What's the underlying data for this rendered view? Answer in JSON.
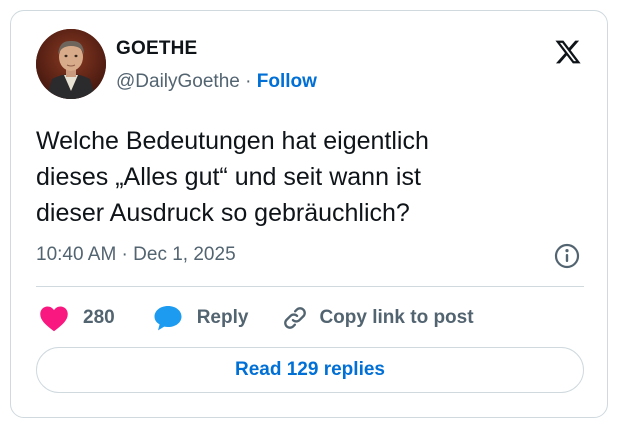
{
  "author": {
    "name": "GOETHE",
    "handle": "@DailyGoethe",
    "separator": " · ",
    "follow_label": "Follow"
  },
  "tweet": {
    "text": "Welche Bedeutungen hat eigentlich\ndieses „Alles gut“ und seit wann ist\ndieser Ausdruck so gebräuchlich?",
    "time": "10:40 AM",
    "separator": " · ",
    "date": "Dec 1, 2025"
  },
  "actions": {
    "like_count": "280",
    "reply_label": "Reply",
    "copy_link_label": "Copy link to post"
  },
  "read_replies_label": "Read 129 replies",
  "icons": {
    "brand": "x-logo-icon",
    "info": "info-icon",
    "like": "heart-icon",
    "reply": "speech-bubble-icon",
    "copy": "link-icon"
  },
  "colors": {
    "like": "#f91880",
    "reply": "#1d9bf0",
    "link": "#006fd6",
    "secondary_text": "#536471",
    "border": "#cfd9de"
  }
}
